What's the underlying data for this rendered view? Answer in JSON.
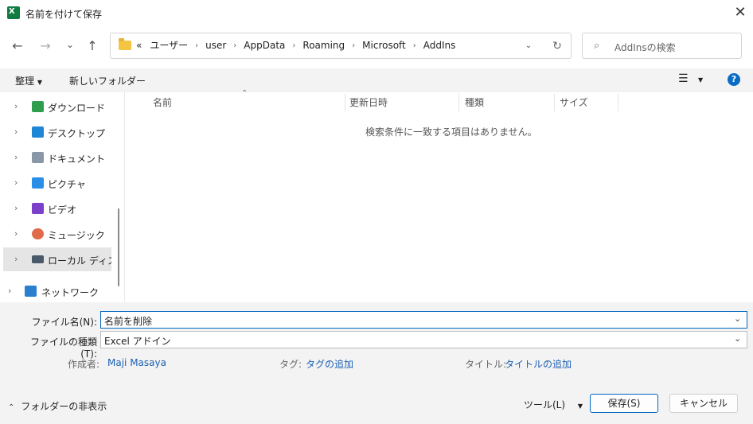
{
  "window": {
    "title": "名前を付けて保存",
    "close_glyph": "✕"
  },
  "nav": {
    "back_glyph": "←",
    "forward_glyph": "→",
    "recent_glyph": "⌄",
    "up_glyph": "↑",
    "address": {
      "overflow": "«",
      "crumbs": [
        "ユーザー",
        "user",
        "AppData",
        "Roaming",
        "Microsoft",
        "AddIns"
      ],
      "sep_glyph": "›",
      "dropdown_glyph": "⌄",
      "refresh_glyph": "↻"
    },
    "search": {
      "icon_glyph": "⌕",
      "placeholder": "AddInsの検索"
    }
  },
  "toolbar": {
    "organize": "整理",
    "organize_arrow": "▼",
    "new_folder": "新しいフォルダー",
    "view_glyph": "☰",
    "view_arrow": "▼",
    "help_glyph": "?"
  },
  "sidebar": {
    "items": [
      {
        "label": "ダウンロード",
        "icon": "download-icon",
        "color": "#2e9d4e"
      },
      {
        "label": "デスクトップ",
        "icon": "desktop-icon",
        "color": "#1f86d6"
      },
      {
        "label": "ドキュメント",
        "icon": "documents-icon",
        "color": "#8a97a8"
      },
      {
        "label": "ピクチャ",
        "icon": "pictures-icon",
        "color": "#2b8ee6"
      },
      {
        "label": "ビデオ",
        "icon": "videos-icon",
        "color": "#7b3fc9"
      },
      {
        "label": "ミュージック",
        "icon": "music-icon",
        "color": "#e06a4a"
      },
      {
        "label": "ローカル ディスク (",
        "icon": "local-disk-icon",
        "color": "#4a5a6b"
      }
    ],
    "network": {
      "label": "ネットワーク",
      "icon": "network-icon",
      "color": "#2a7fcf"
    },
    "chev_glyph": "›"
  },
  "file_list": {
    "columns": [
      "名前",
      "更新日時",
      "種類",
      "サイズ"
    ],
    "sort_glyph": "⌃",
    "empty_message": "検索条件に一致する項目はありません。"
  },
  "save_form": {
    "filename_label": "ファイル名(N):",
    "filename_value": "名前を削除",
    "filetype_label": "ファイルの種類(T):",
    "filetype_value": "Excel アドイン",
    "dd_glyph": "⌄",
    "author_label": "作成者:",
    "author_value": "Maji Masaya",
    "tags_label": "タグ:",
    "tags_value": "タグの追加",
    "title_label": "タイトル:",
    "title_value": "タイトルの追加"
  },
  "footer": {
    "hide_folders": "フォルダーの非表示",
    "hide_glyph": "⌃",
    "tools": "ツール(L)",
    "tools_arrow": "▼",
    "save": "保存(S)",
    "cancel": "キャンセル"
  },
  "colors": {
    "accent": "#0067c0",
    "link": "#1a5fb4",
    "panel": "#f3f3f3"
  }
}
